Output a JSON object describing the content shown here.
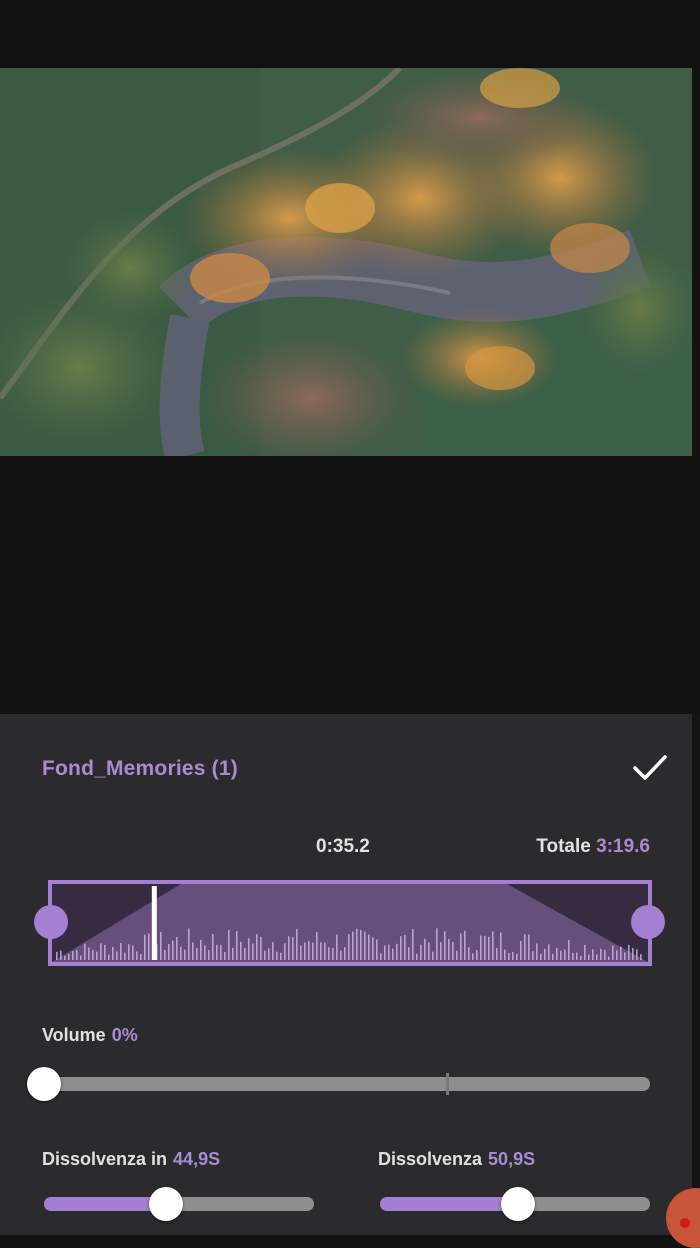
{
  "track": {
    "title": "Fond_Memories (1)",
    "current_time": "0:35.2",
    "total_label": "Totale",
    "total_value": "3:19.6",
    "playhead_fraction": 0.176
  },
  "volume": {
    "label": "Volume",
    "value": "0%",
    "level": 0.0
  },
  "fade_in": {
    "label": "Dissolvenza in",
    "value": "44,9S",
    "level": 0.45
  },
  "fade_out": {
    "label": "Dissolvenza",
    "value": "50,9S",
    "level": 0.51
  },
  "colors": {
    "accent": "#a98bd4",
    "panel": "#2b2b2d",
    "background": "#121212"
  },
  "icons": {
    "confirm": "checkmark-icon"
  }
}
